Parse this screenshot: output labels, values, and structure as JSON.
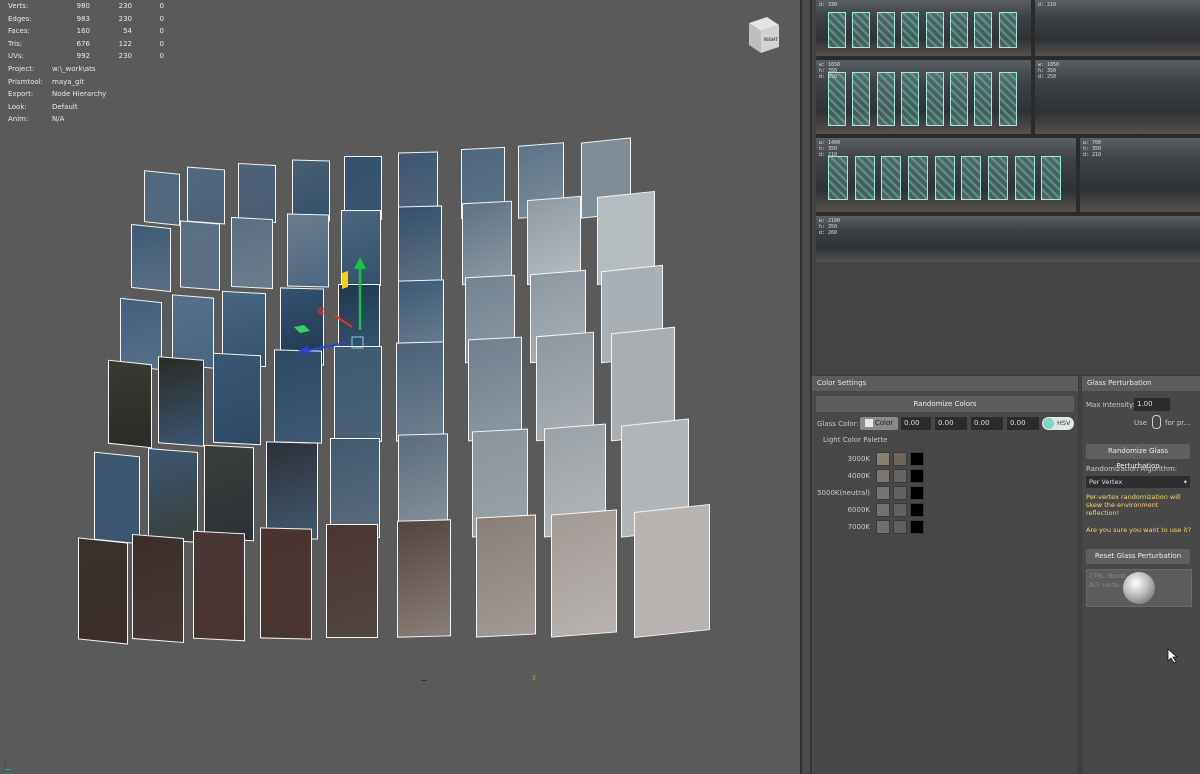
{
  "viewport": {
    "stats": [
      {
        "label": "Verts:",
        "a": "980",
        "b": "230",
        "c": "0"
      },
      {
        "label": "Edges:",
        "a": "983",
        "b": "230",
        "c": "0"
      },
      {
        "label": "Faces:",
        "a": "160",
        "b": "54",
        "c": "0"
      },
      {
        "label": "Tris:",
        "a": "676",
        "b": "122",
        "c": "0"
      },
      {
        "label": "UVs:",
        "a": "992",
        "b": "230",
        "c": "0"
      }
    ],
    "info": [
      {
        "label": "Project:",
        "value": "w:\\_work\\ats"
      },
      {
        "label": "Prismtool:",
        "value": "maya_git"
      },
      {
        "label": "Export:",
        "value": "Node Hierarchy"
      },
      {
        "label": "Look:",
        "value": "Default"
      },
      {
        "label": "Anim:",
        "value": "N/A"
      }
    ],
    "viewcube_label": "RIGHT",
    "marker_label": "3"
  },
  "references": [
    {
      "dims": "d: 330"
    },
    {
      "dims": "d: 210"
    },
    {
      "dims": "w: 1650\nh: 350\nd: 250"
    },
    {
      "dims": "w: 1050\nh: 350\nd: 250"
    },
    {
      "dims": "w: 1400\nh: 350\nd: 210"
    },
    {
      "dims": "w: 700\nh: 350\nd: 210"
    },
    {
      "dims": "w: 2100\nh: 350\nd: 260"
    }
  ],
  "color_settings": {
    "title": "Color Settings",
    "randomize_label": "Randomize Colors",
    "glass_color_label": "Glass Color:",
    "color_button_label": "Color",
    "values": [
      "0.00",
      "0.00",
      "0.00",
      "0.00"
    ],
    "hsv_label": "HSV",
    "palette_title": "Light Color Palette",
    "palette": [
      {
        "label": "3000K",
        "colors": [
          "#8a8070",
          "#6e665c",
          "#000000"
        ]
      },
      {
        "label": "4000K",
        "colors": [
          "#7a7670",
          "#666360",
          "#000000"
        ]
      },
      {
        "label": "5000K(neutral)",
        "colors": [
          "#747474",
          "#626262",
          "#000000"
        ]
      },
      {
        "label": "6000K",
        "colors": [
          "#707274",
          "#5f6163",
          "#000000"
        ]
      },
      {
        "label": "7000K",
        "colors": [
          "#6c7074",
          "#5c5f63",
          "#000000"
        ]
      }
    ]
  },
  "glass_perturbation": {
    "title": "Glass Perturbation",
    "max_intensity_label": "Max Intensity:",
    "max_intensity_value": "1.00",
    "use_label": "Use",
    "for_label": "for pr...",
    "randomize_label": "Randomize Glass Perturbation",
    "algorithm_label": "Randomization Algorithm:",
    "algorithm_value": "Per Vertex",
    "warning_lines": [
      "Per-vertex randomization will",
      "skew the environment",
      "reflection!"
    ],
    "question": "Are you sure you want to use it?",
    "reset_label": "Reset Glass Perturbation",
    "tooltip_lines": [
      "CTRL: Bomb...",
      "ALT: verte..."
    ]
  },
  "colors": {
    "accent": "#7fd6c8",
    "warning": "#ffd166",
    "viewport_bg": "#5a5a5a"
  }
}
